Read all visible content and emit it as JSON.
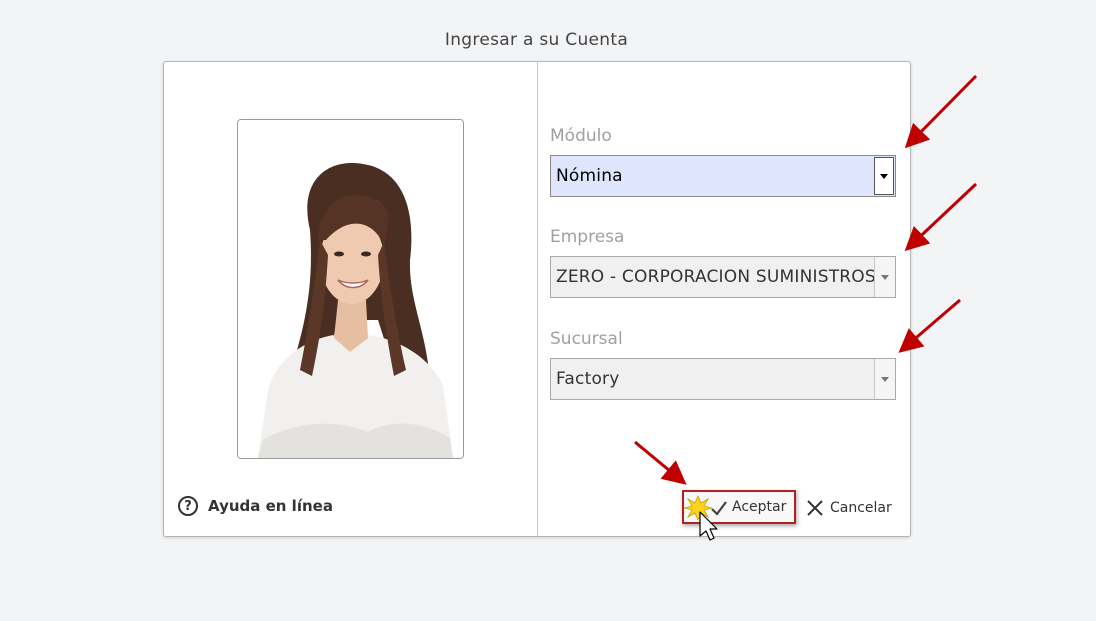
{
  "window": {
    "title": "Ingresar a su Cuenta"
  },
  "help": {
    "label": "Ayuda en línea",
    "icon": "question-circle-icon"
  },
  "form": {
    "modulo": {
      "label": "Módulo",
      "value": "Nómina"
    },
    "empresa": {
      "label": "Empresa",
      "value": "ZERO - CORPORACION SUMINISTROS"
    },
    "sucursal": {
      "label": "Sucursal",
      "value": "Factory"
    }
  },
  "actions": {
    "accept_label": "Aceptar",
    "cancel_label": "Cancelar"
  },
  "colors": {
    "annotation_arrow": "#c00000",
    "active_select_bg": "#dfe5fd",
    "accept_border": "#b22222"
  }
}
